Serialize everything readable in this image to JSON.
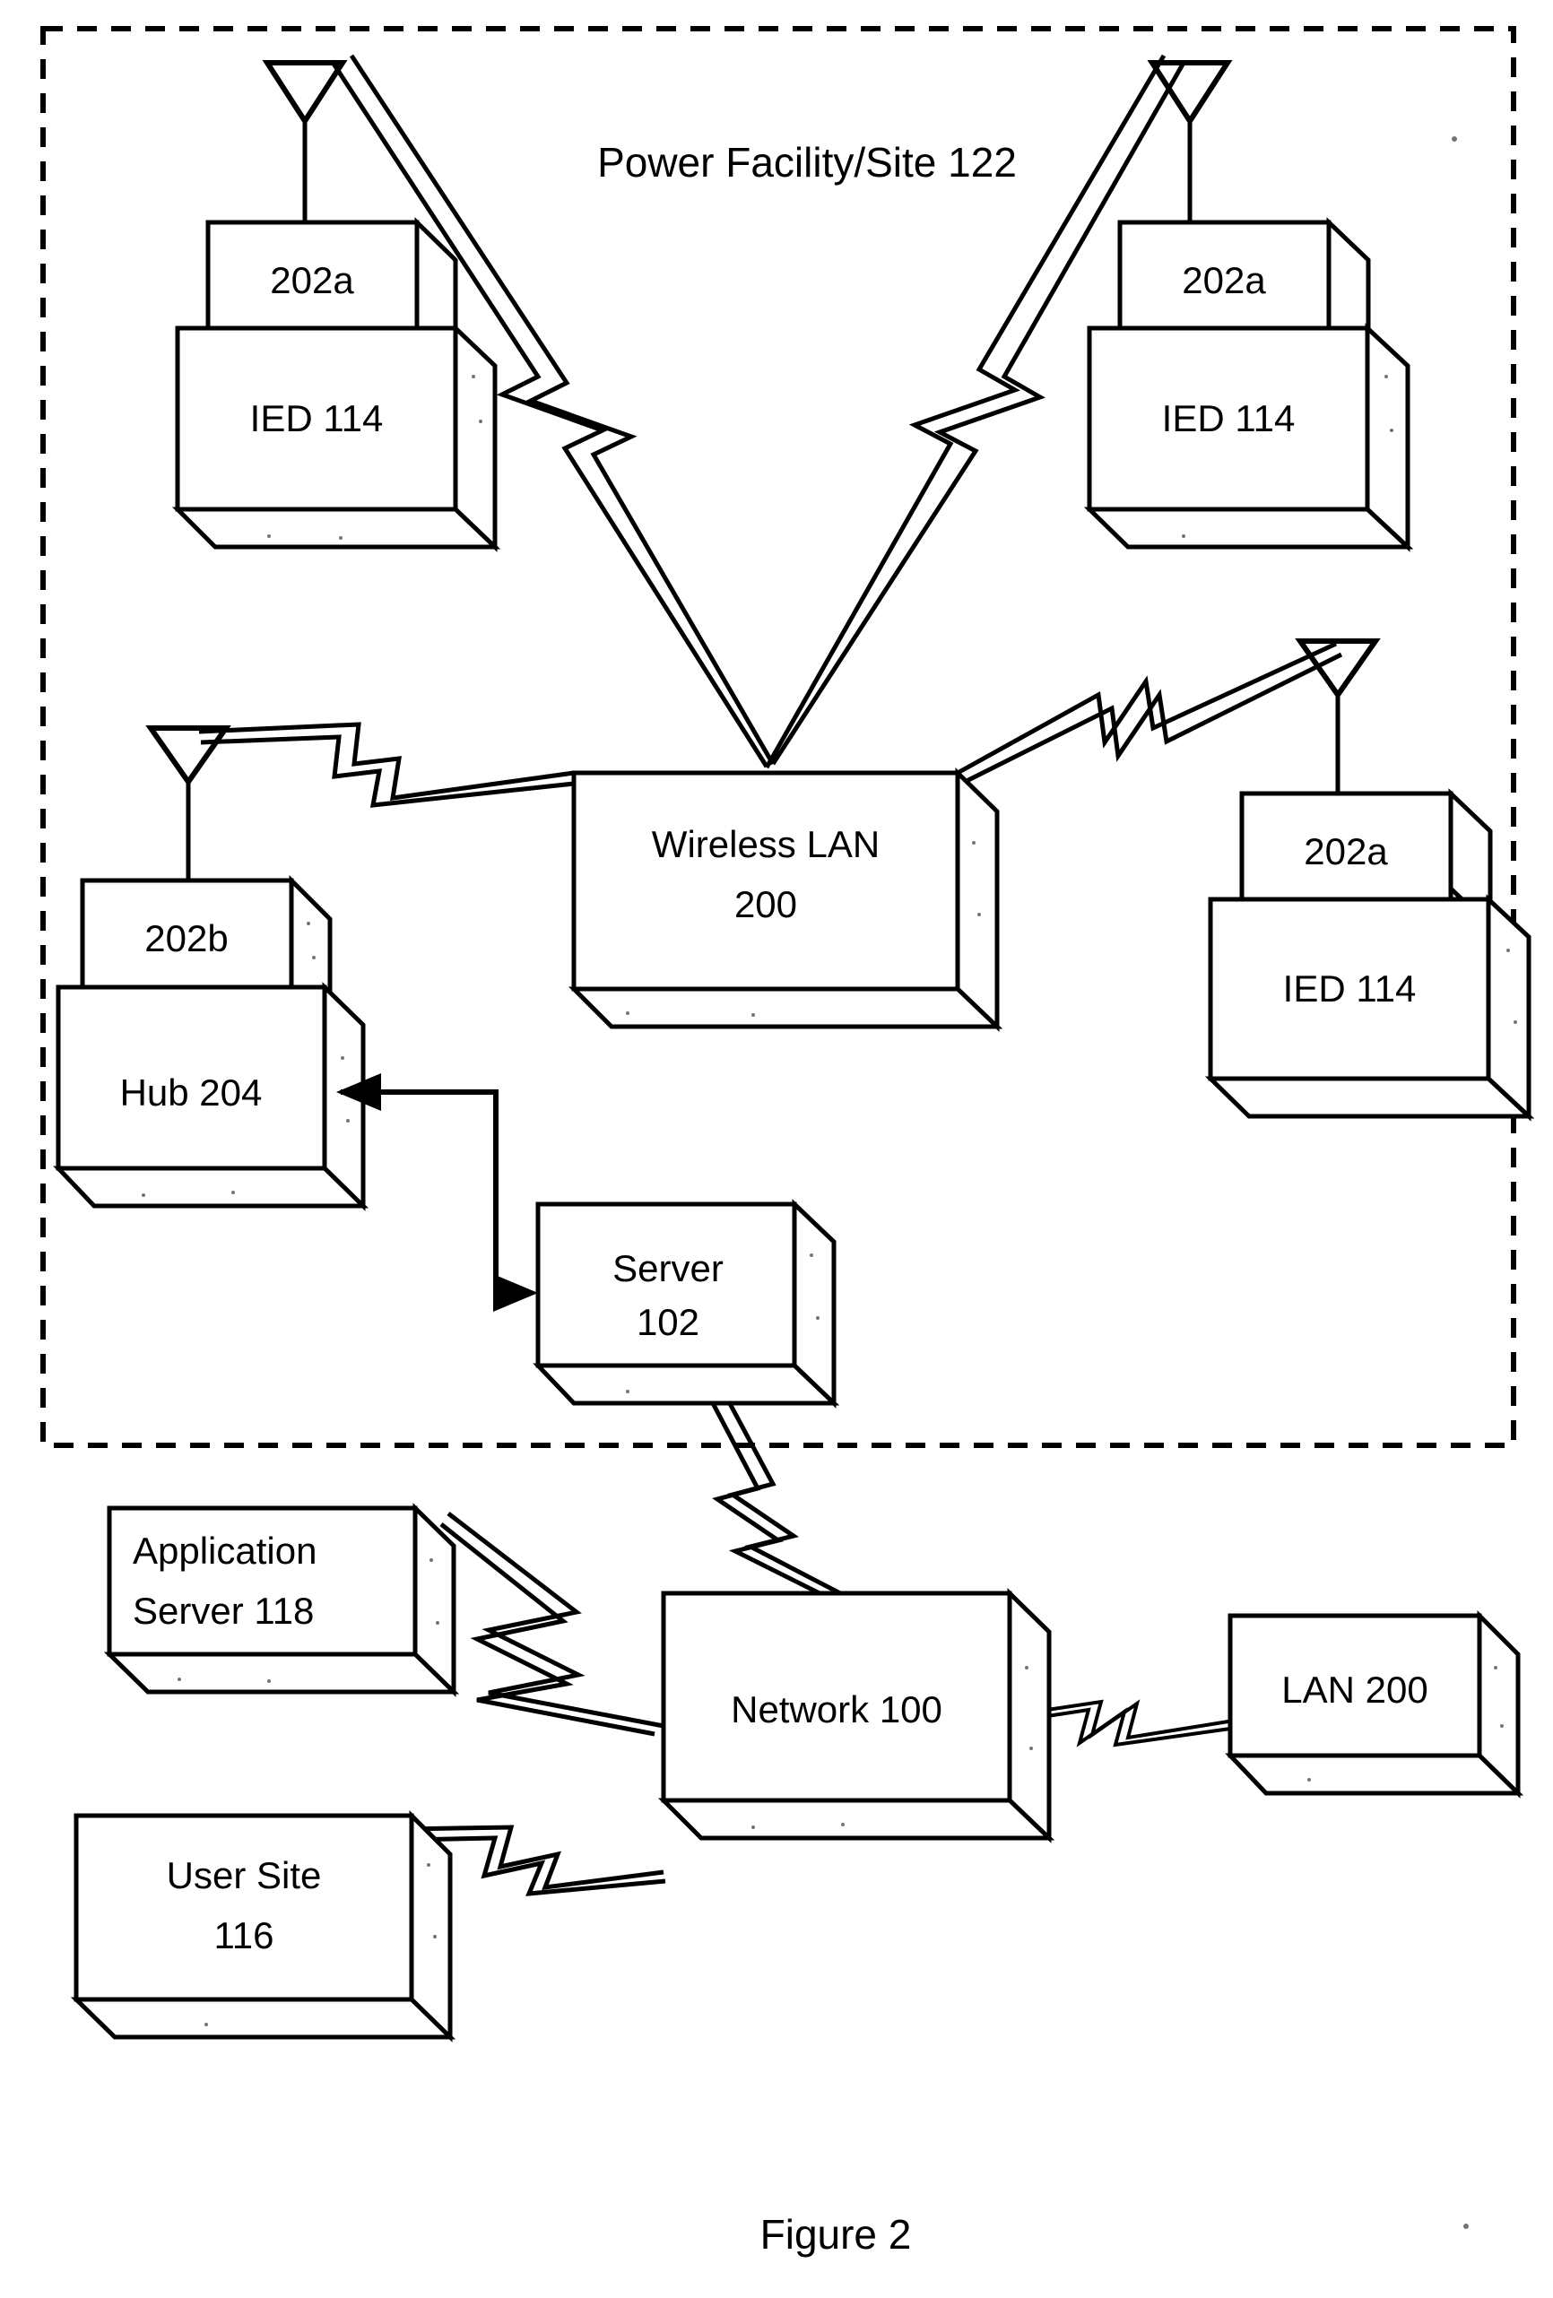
{
  "figure": {
    "caption": "Figure 2",
    "boundary_label": "Power Facility/Site 122"
  },
  "nodes": {
    "radio_top_left": {
      "label": "202a"
    },
    "ied_top_left": {
      "label": "IED 114"
    },
    "radio_top_right": {
      "label": "202a"
    },
    "ied_top_right": {
      "label": "IED 114"
    },
    "radio_mid_right": {
      "label": "202a"
    },
    "ied_mid_right": {
      "label": "IED 114"
    },
    "radio_hub": {
      "label": "202b"
    },
    "hub": {
      "label": "Hub 204"
    },
    "wireless_lan": {
      "label_line1": "Wireless LAN",
      "label_line2": "200"
    },
    "server": {
      "label_line1": "Server",
      "label_line2": "102"
    },
    "application_server": {
      "label_line1": "Application",
      "label_line2": "Server 118"
    },
    "network": {
      "label": "Network 100"
    },
    "lan": {
      "label": "LAN 200"
    },
    "user_site": {
      "label_line1": "User Site",
      "label_line2": "116"
    }
  },
  "connections": [
    {
      "name": "wireless-link-ied-top-left",
      "type": "wireless",
      "from": "radio_top_left",
      "to": "wireless_lan"
    },
    {
      "name": "wireless-link-ied-top-right",
      "type": "wireless",
      "from": "radio_top_right",
      "to": "wireless_lan"
    },
    {
      "name": "wireless-link-hub",
      "type": "wireless",
      "from": "radio_hub",
      "to": "wireless_lan"
    },
    {
      "name": "wireless-link-ied-mid-right",
      "type": "wireless",
      "from": "radio_mid_right",
      "to": "wireless_lan"
    },
    {
      "name": "data-link-hub-server",
      "type": "arrow-bidirectional",
      "from": "hub",
      "to": "server"
    },
    {
      "name": "wireless-link-server-network",
      "type": "wireless",
      "from": "server",
      "to": "network"
    },
    {
      "name": "wireless-link-appserver-network",
      "type": "wireless",
      "from": "application_server",
      "to": "network"
    },
    {
      "name": "wireless-link-usersite-network",
      "type": "wireless",
      "from": "user_site",
      "to": "network"
    },
    {
      "name": "wireless-link-network-lan",
      "type": "wireless",
      "from": "network",
      "to": "lan"
    }
  ],
  "colors": {
    "stroke": "#000000",
    "fill": "#ffffff"
  }
}
